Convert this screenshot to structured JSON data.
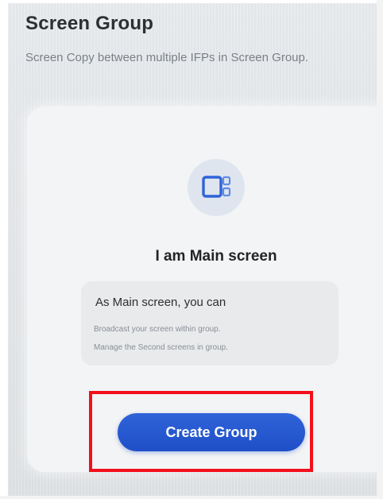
{
  "header": {
    "title": "Screen Group",
    "subtitle": "Screen Copy between multiple IFPs in Screen Group."
  },
  "card": {
    "icon": "screen-group-icon",
    "heading": "I am Main screen",
    "info": {
      "title": "As Main screen, you can",
      "lines": [
        "Broadcast your screen within group.",
        "Manage the Second screens in group."
      ]
    },
    "button_label": "Create Group"
  },
  "colors": {
    "accent": "#1f4fc8",
    "icon": "#2f63d8",
    "highlight": "#f2101a",
    "title_text": "#2d2f33",
    "subtitle_text": "#7b8087"
  }
}
